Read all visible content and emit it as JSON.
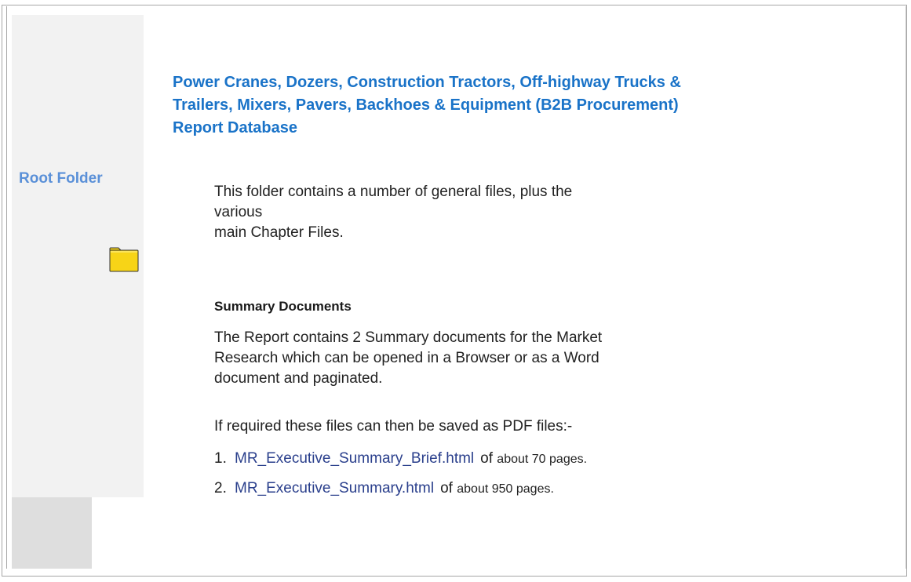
{
  "sidebar": {
    "root_folder_label": "Root Folder",
    "folder_icon": "folder-icon",
    "folder_icon_color": "#f7d417"
  },
  "header": {
    "title_line_1": "Power Cranes, Dozers, Construction Tractors, Off-highway Trucks &",
    "title_line_2": "Trailers, Mixers, Pavers, Backhoes & Equipment (B2B Procurement)",
    "title_line_3": "Report Database"
  },
  "intro": {
    "line_1": "This folder contains a number of general files, plus the various",
    "line_2": "main Chapter Files."
  },
  "summary": {
    "heading": "Summary Documents",
    "para_line_1": "The Report contains 2 Summary documents for the Market",
    "para_line_2": "Research which can be opened in a Browser or as a Word",
    "para_line_3": "document and paginated.",
    "pdf_note": "If required these files can then be saved as PDF files:-",
    "documents": [
      {
        "number": "1.",
        "filename": "MR_Executive_Summary_Brief.html",
        "of": "of",
        "pages": "about 70 pages."
      },
      {
        "number": "2.",
        "filename": "MR_Executive_Summary.html",
        "of": "of",
        "pages": "about 950 pages."
      }
    ]
  },
  "colors": {
    "title": "#1a73c8",
    "root_folder_label": "#5a90d8",
    "link": "#2a3f8c",
    "sidebar_bg": "#f2f2f2"
  }
}
